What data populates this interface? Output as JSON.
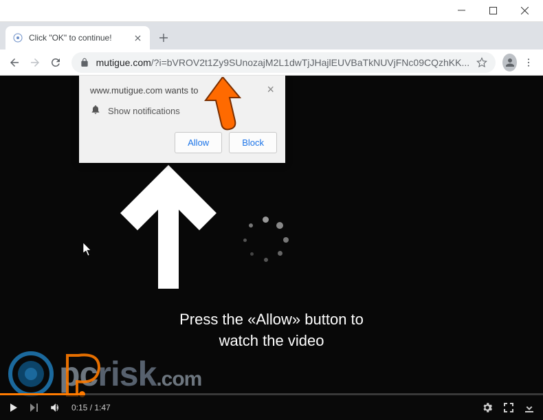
{
  "window": {
    "tab_title": "Click \"OK\" to continue!"
  },
  "toolbar": {
    "url_domain": "mutigue.com",
    "url_path": "/?i=bVROV2t1Zy9SUnozajM2L1dwTjJHajlEUVBaTkNUVjFNc09CQzhKK..."
  },
  "notification": {
    "origin": "www.mutigue.com wants to",
    "body": "Show notifications",
    "allow": "Allow",
    "block": "Block"
  },
  "page": {
    "instruction_line1": "Press the «Allow» button to",
    "instruction_line2": "watch the video"
  },
  "watermark": {
    "p": "p",
    "c": "c",
    "risk": "risk",
    "dotcom": ".com"
  },
  "video": {
    "current": "0:15",
    "sep": " / ",
    "total": "1:47"
  }
}
